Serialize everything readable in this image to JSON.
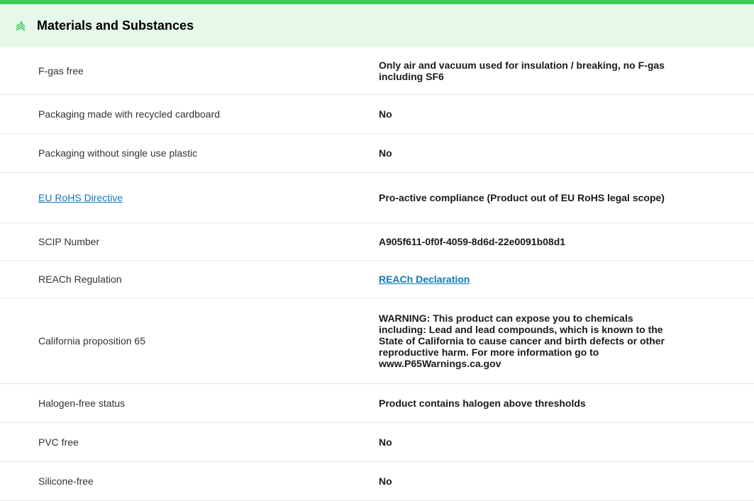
{
  "section": {
    "title": "Materials and Substances",
    "icon": "leaf-layers-icon",
    "accent_color": "#3dcd58",
    "header_bg": "#e6f8e9",
    "link_color": "#0e7ab8"
  },
  "rows": [
    {
      "label": "F-gas free",
      "value": "Only air and vacuum used for insulation / breaking, no F-gas including SF6"
    },
    {
      "label": "Packaging made with recycled cardboard",
      "value": "No"
    },
    {
      "label": "Packaging without single use plastic",
      "value": "No"
    },
    {
      "label": "EU RoHS Directive",
      "value": "Pro-active compliance (Product out of EU RoHS legal scope)"
    },
    {
      "label": "SCIP Number",
      "value": "A905f611-0f0f-4059-8d6d-22e0091b08d1"
    },
    {
      "label": "REACh Regulation",
      "value": "REACh Declaration"
    },
    {
      "label": "California proposition 65",
      "value": "WARNING: This product can expose you to chemicals including: Lead and lead compounds, which is known to the State of California to cause cancer and birth defects or other reproductive harm. For more information go to www.P65Warnings.ca.gov"
    },
    {
      "label": "Halogen-free status",
      "value": "Product contains halogen above thresholds"
    },
    {
      "label": "PVC free",
      "value": "No"
    },
    {
      "label": "Silicone-free",
      "value": "No"
    }
  ]
}
